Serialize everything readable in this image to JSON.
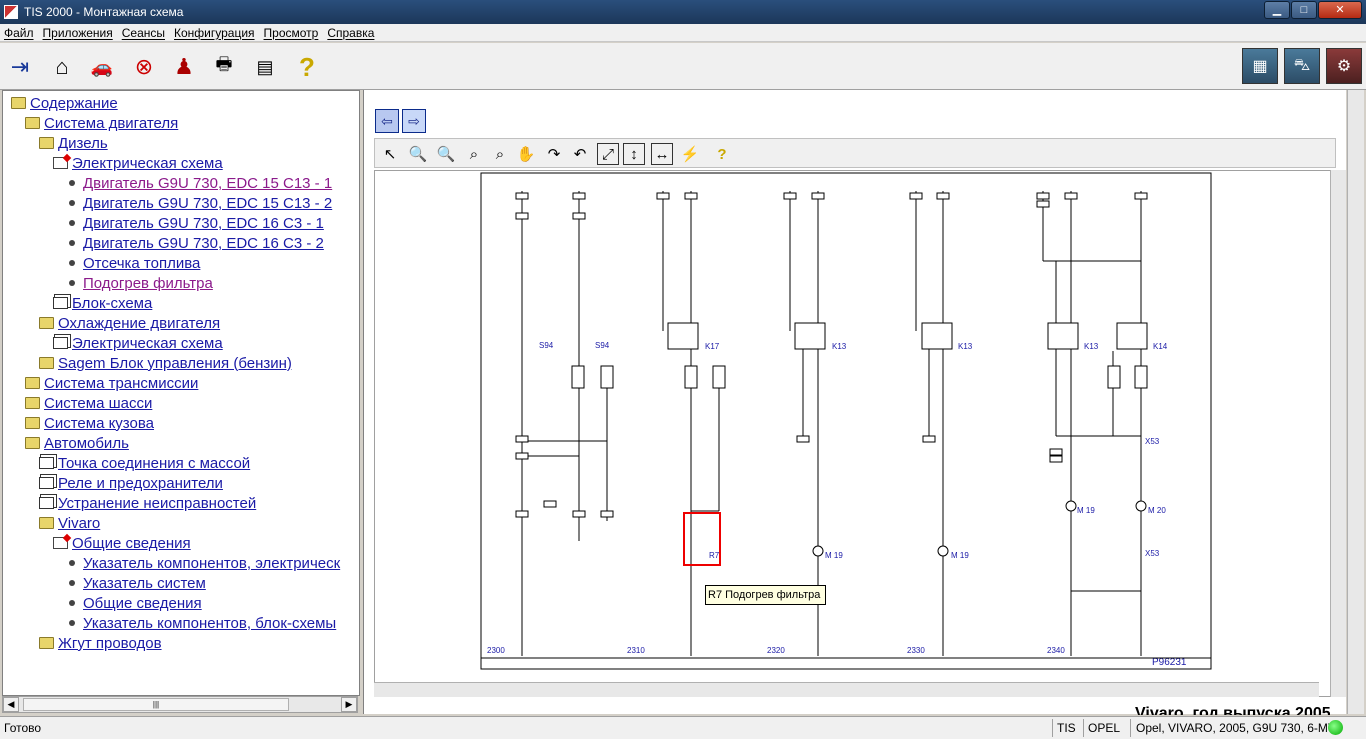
{
  "window": {
    "title": "TIS 2000 - Монтажная схема"
  },
  "menu": [
    "Файл",
    "Приложения",
    "Сеансы",
    "Конфигурация",
    "Просмотр",
    "Справка"
  ],
  "toolbar": {
    "icons": [
      "exit-icon",
      "home-icon",
      "vehicle-select-icon",
      "stop-icon",
      "user-icon",
      "print-icon",
      "notepad-icon",
      "help-icon"
    ],
    "right_icons": [
      "diagnostics-icon",
      "vehicle-icon",
      "service-icon"
    ]
  },
  "tree": [
    {
      "label": "Содержание",
      "level": 0,
      "icon": "folder"
    },
    {
      "label": "Система двигателя",
      "level": 1,
      "icon": "folder"
    },
    {
      "label": "Дизель",
      "level": 2,
      "icon": "folder"
    },
    {
      "label": "Электрическая схема",
      "level": 3,
      "icon": "doc"
    },
    {
      "label": "Двигатель G9U 730, EDC 15 C13 - 1",
      "level": 4,
      "icon": "bullet",
      "visited": true
    },
    {
      "label": "Двигатель G9U 730, EDC 15 C13 - 2",
      "level": 4,
      "icon": "bullet"
    },
    {
      "label": "Двигатель G9U 730, EDC 16 C3 - 1",
      "level": 4,
      "icon": "bullet"
    },
    {
      "label": "Двигатель G9U 730, EDC 16 C3 - 2",
      "level": 4,
      "icon": "bullet"
    },
    {
      "label": "Отсечка топлива",
      "level": 4,
      "icon": "bullet"
    },
    {
      "label": "Подогрев фильтра",
      "level": 4,
      "icon": "bullet",
      "visited": true
    },
    {
      "label": "Блок-схема",
      "level": 3,
      "icon": "book"
    },
    {
      "label": "Охлаждение двигателя",
      "level": 2,
      "icon": "folder"
    },
    {
      "label": "Электрическая схема",
      "level": 3,
      "icon": "book"
    },
    {
      "label": "Sagem Блок управления (бензин)",
      "level": 2,
      "icon": "folder"
    },
    {
      "label": "Система трансмиссии",
      "level": 1,
      "icon": "folder"
    },
    {
      "label": "Система шасси",
      "level": 1,
      "icon": "folder"
    },
    {
      "label": "Система кузова",
      "level": 1,
      "icon": "folder"
    },
    {
      "label": "Автомобиль",
      "level": 1,
      "icon": "folder"
    },
    {
      "label": "Точка соединения с массой",
      "level": 2,
      "icon": "book"
    },
    {
      "label": "Реле и предохранители",
      "level": 2,
      "icon": "book"
    },
    {
      "label": "Устранение неисправностей",
      "level": 2,
      "icon": "book"
    },
    {
      "label": "Vivaro",
      "level": 2,
      "icon": "folder"
    },
    {
      "label": "Общие сведения",
      "level": 3,
      "icon": "doc"
    },
    {
      "label": "Указатель компонентов, электрическ",
      "level": 4,
      "icon": "bullet"
    },
    {
      "label": "Указатель систем",
      "level": 4,
      "icon": "bullet"
    },
    {
      "label": "Общие сведения",
      "level": 4,
      "icon": "bullet"
    },
    {
      "label": "Указатель компонентов, блок-схемы",
      "level": 4,
      "icon": "bullet"
    },
    {
      "label": "Жгут проводов",
      "level": 2,
      "icon": "folder"
    }
  ],
  "schematic": {
    "tooltip": "R7 Подогрев фильтра",
    "diagram_number": "P96231",
    "components": [
      "S94",
      "S94",
      "K17",
      "K13",
      "K13",
      "K13",
      "K14",
      "M 19",
      "M 19",
      "M 19",
      "M 20",
      "R7",
      "X53",
      "X53"
    ],
    "ruler": [
      "2300",
      "2310",
      "2320",
      "2330",
      "2340"
    ],
    "footer_text": "Vivaro, год выпуска 2005"
  },
  "status": {
    "ready": "Готово",
    "mode": "TIS",
    "brand": "OPEL",
    "vehicle": "Opel, VIVARO, 2005, G9U 730, 6-MT"
  }
}
